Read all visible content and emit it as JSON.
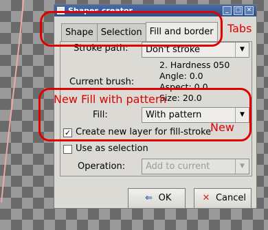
{
  "dialog": {
    "title": "Shapes creator",
    "title_buttons": {
      "minimize": "_",
      "maximize": "□",
      "close": "✕"
    },
    "tabs": [
      {
        "label": "Shape",
        "active": false
      },
      {
        "label": "Selection",
        "active": false
      },
      {
        "label": "Fill and border",
        "active": true
      }
    ],
    "stroke_path": {
      "label": "Stroke path:",
      "value": "Don't stroke"
    },
    "current_brush": {
      "label": "Current brush:",
      "lines": [
        "2. Hardness 050",
        "Angle: 0.0",
        "Aspect: 0.0",
        "Size: 20.0"
      ]
    },
    "fill": {
      "label": "Fill:",
      "value": "With pattern"
    },
    "create_new_layer": {
      "label": "Create new layer for fill-stroke",
      "checked": true,
      "mark": "✓"
    },
    "use_as_selection": {
      "label": "Use as selection",
      "checked": false
    },
    "operation": {
      "label": "Operation:",
      "value": "Add to current",
      "disabled": true
    },
    "buttons": {
      "ok": {
        "label": "OK",
        "icon": "⇐"
      },
      "cancel": {
        "label": "Cancel",
        "icon": "✕"
      }
    },
    "dropdown_arrow": "▼"
  },
  "annotations": {
    "tabs": "Tabs",
    "fill_pattern": "New Fill with pattern",
    "new": "New",
    "color": "#e10000"
  }
}
